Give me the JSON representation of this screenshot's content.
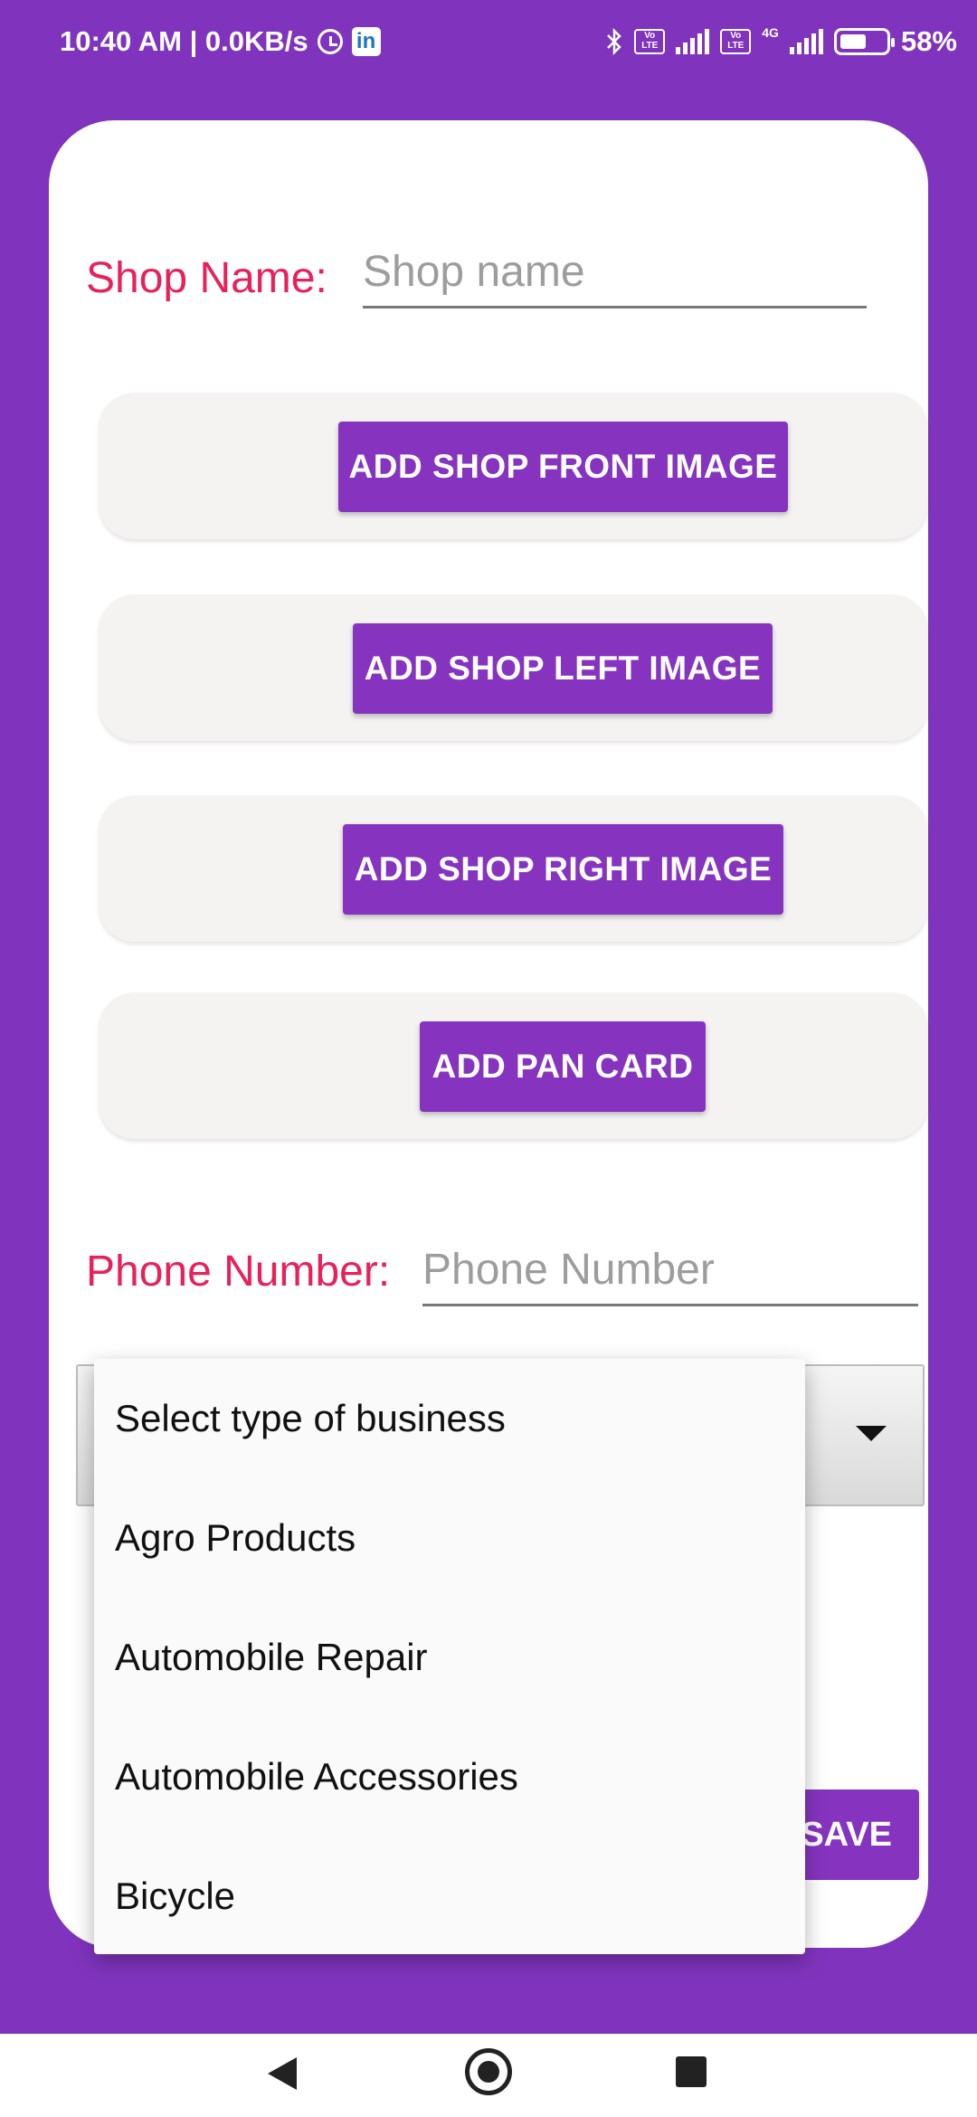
{
  "status_bar": {
    "time_speed": "10:40 AM | 0.0KB/s",
    "linkedin_glyph": "in",
    "sim1": "Vo LTE",
    "sim2": "Vo LTE",
    "network": "4G",
    "battery": "58%"
  },
  "form": {
    "shop_name_label": "Shop Name:",
    "shop_name_placeholder": "Shop name",
    "phone_label": "Phone Number:",
    "phone_placeholder": "Phone Number",
    "buttons": {
      "front": "ADD SHOP FRONT IMAGE",
      "left": "ADD SHOP LEFT IMAGE",
      "right": "ADD SHOP RIGHT IMAGE",
      "pan": "ADD PAN CARD",
      "save": "SAVE"
    }
  },
  "business_dropdown": {
    "options": [
      "Select type of business",
      "Agro Products",
      "Automobile Repair",
      "Automobile Accessories",
      "Bicycle"
    ]
  },
  "icons": {
    "alarm": "alarm-icon",
    "linkedin": "linkedin-icon",
    "bluetooth": "bluetooth-icon",
    "signal": "signal-icon",
    "battery": "battery-icon",
    "spinner_caret": "caret-down-icon",
    "nav_back": "back-icon",
    "nav_home": "home-icon",
    "nav_recent": "recents-icon"
  },
  "colors": {
    "background": "#8034BE",
    "accent": "#8634C0",
    "label": "#E8215A"
  }
}
